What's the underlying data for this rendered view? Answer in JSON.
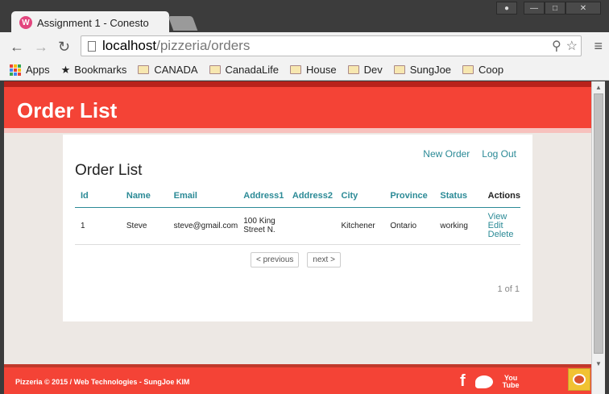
{
  "browser": {
    "tab_title": "Assignment 1 - Conesto",
    "tab_favicon_letter": "W",
    "tab_close": "×",
    "url_host": "localhost",
    "url_path": "/pizzeria/orders",
    "window_buttons": {
      "user": "●",
      "minimize": "—",
      "maximize": "□",
      "close": "✕"
    },
    "nav": {
      "back": "←",
      "forward": "→",
      "reload": "↻"
    },
    "omni_icons": {
      "zoom": "⚲",
      "star": "☆"
    },
    "menu": "≡"
  },
  "bookmarks": {
    "apps": "Apps",
    "bookmarks": "Bookmarks",
    "folders": [
      "CANADA",
      "CanadaLife",
      "House",
      "Dev",
      "SungJoe",
      "Coop"
    ],
    "apps_colors": [
      "#ea4335",
      "#fbbc05",
      "#34a853",
      "#4285f4",
      "#ea4335",
      "#fbbc05",
      "#34a853",
      "#4285f4",
      "#ea4335"
    ]
  },
  "page": {
    "header_title": "Order List",
    "new_order": "New Order",
    "log_out": "Log Out",
    "title": "Order List",
    "columns": [
      "Id",
      "Name",
      "Email",
      "Address1",
      "Address2",
      "City",
      "Province",
      "Status",
      "Actions"
    ],
    "rows": [
      {
        "id": "1",
        "name": "Steve",
        "email": "steve@gmail.com",
        "address1_line1": "100 King",
        "address1_line2": "Street N.",
        "address2": "",
        "city": "Kitchener",
        "province": "Ontario",
        "status": "working",
        "action_view": "View",
        "action_edit": "Edit",
        "action_delete": "Delete"
      }
    ],
    "prev": "< previous",
    "next": "next >",
    "page_count": "1 of 1",
    "footer_text": "Pizzeria © 2015 / Web Technologies - SungJoe KIM",
    "social": {
      "facebook": "f",
      "youtube_line1": "You",
      "youtube_line2": "Tube"
    }
  },
  "colors": {
    "header": "#f44336",
    "link": "#2b8a96"
  },
  "scrollbar": {
    "up": "▲",
    "down": "▼"
  }
}
